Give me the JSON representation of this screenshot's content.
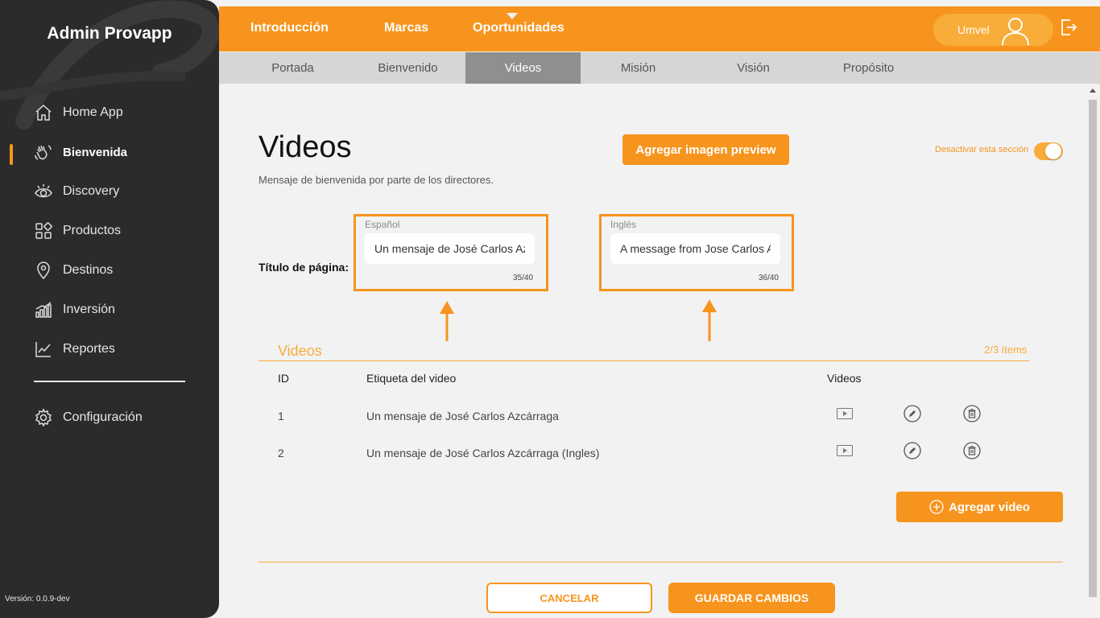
{
  "sidebar": {
    "title": "Admin Provapp",
    "items": [
      {
        "label": "Home App",
        "icon": "home-icon"
      },
      {
        "label": "Bienvenida",
        "icon": "waving-hand-icon",
        "active": true
      },
      {
        "label": "Discovery",
        "icon": "eye-icon"
      },
      {
        "label": "Productos",
        "icon": "grid-icon"
      },
      {
        "label": "Destinos",
        "icon": "map-pin-icon"
      },
      {
        "label": "Inversión",
        "icon": "bar-chart-icon"
      },
      {
        "label": "Reportes",
        "icon": "line-chart-icon"
      },
      {
        "label": "Configuración",
        "icon": "gear-icon"
      }
    ],
    "version": "Versión: 0.0.9-dev"
  },
  "topnav": {
    "tabs": [
      "Introducción",
      "Marcas",
      "Oportunidades"
    ],
    "active": "Introducción",
    "user_name": "Umvel"
  },
  "subnav": {
    "tabs": [
      "Portada",
      "Bienvenido",
      "Videos",
      "Misión",
      "Visión",
      "Propósito"
    ],
    "active": "Videos"
  },
  "page": {
    "title": "Videos",
    "subtitle": "Mensaje de bienvenida por parte de los directores.",
    "preview_button": "Agregar imagen preview",
    "toggle_label": "Desactivar esta sección",
    "toggle_on": true
  },
  "title_field": {
    "label": "Título de página:",
    "spanish": {
      "lang": "Español",
      "value": "Un mensaje de José Carlos Az",
      "count": "35/40"
    },
    "english": {
      "lang": "Inglés",
      "value": "A message from Jose Carlos A",
      "count": "36/40"
    }
  },
  "videos": {
    "section_title": "Videos",
    "count": "2/3 ítems",
    "headers": {
      "id": "ID",
      "label": "Etiqueta del video",
      "videos": "Videos"
    },
    "rows": [
      {
        "id": "1",
        "label": "Un mensaje de José Carlos Azcárraga"
      },
      {
        "id": "2",
        "label": "Un mensaje de José Carlos Azcárraga (Ingles)"
      }
    ],
    "add_button": "Agregar video"
  },
  "footer": {
    "cancel": "CANCELAR",
    "save": "GUARDAR CAMBIOS"
  },
  "colors": {
    "accent": "#f7941d",
    "sidebar": "#2b2b2b",
    "subnav": "#d6d6d6",
    "subnav_active": "#8f8f8f"
  }
}
